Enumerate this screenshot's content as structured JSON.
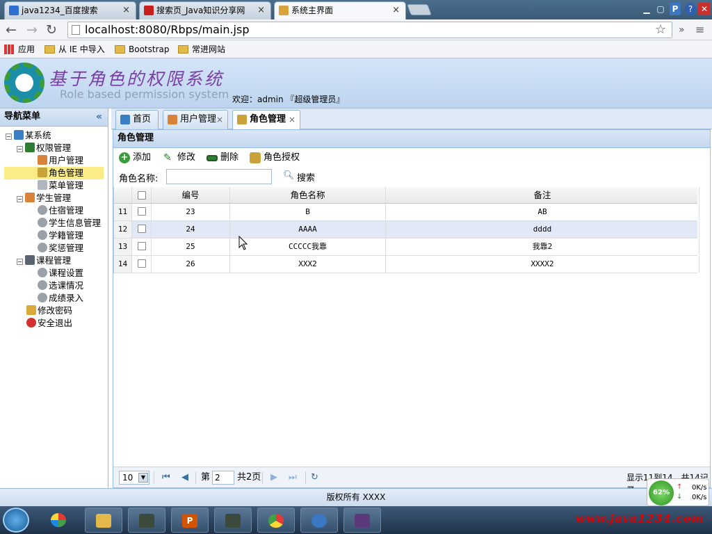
{
  "browser": {
    "tabs": [
      {
        "label": "java1234_百度搜索"
      },
      {
        "label": "搜索页_Java知识分享网"
      },
      {
        "label": "系统主界面"
      }
    ],
    "url": "localhost:8080/Rbps/main.jsp",
    "bookmarks": [
      {
        "label": "应用"
      },
      {
        "label": "从 IE 中导入"
      },
      {
        "label": "Bootstrap"
      },
      {
        "label": "常进网站"
      }
    ]
  },
  "header": {
    "title_cn": "基于角色的权限系统",
    "title_en": "Role based permission system",
    "welcome": "欢迎：admin 『超级管理员』"
  },
  "sidebar": {
    "title": "导航菜单",
    "tree": [
      {
        "label": "某系统"
      },
      {
        "label": "权限管理"
      },
      {
        "label": "用户管理"
      },
      {
        "label": "角色管理"
      },
      {
        "label": "菜单管理"
      },
      {
        "label": "学生管理"
      },
      {
        "label": "住宿管理"
      },
      {
        "label": "学生信息管理"
      },
      {
        "label": "学籍管理"
      },
      {
        "label": "奖惩管理"
      },
      {
        "label": "课程管理"
      },
      {
        "label": "课程设置"
      },
      {
        "label": "选课情况"
      },
      {
        "label": "成绩录入"
      },
      {
        "label": "修改密码"
      },
      {
        "label": "安全退出"
      }
    ]
  },
  "page_tabs": [
    {
      "label": "首页"
    },
    {
      "label": "用户管理"
    },
    {
      "label": "角色管理"
    }
  ],
  "panel": {
    "title": "角色管理",
    "toolbar": {
      "add": "添加",
      "edit": "修改",
      "delete": "删除",
      "grant": "角色授权"
    },
    "search": {
      "label": "角色名称:",
      "button": "搜索",
      "value": ""
    }
  },
  "grid": {
    "columns": [
      "编号",
      "角色名称",
      "备注"
    ],
    "rows": [
      {
        "rownum": "11",
        "id": "23",
        "name": "B",
        "remark": "AB"
      },
      {
        "rownum": "12",
        "id": "24",
        "name": "AAAA",
        "remark": "dddd"
      },
      {
        "rownum": "13",
        "id": "25",
        "name": "CCCCC我靠",
        "remark": "我靠2"
      },
      {
        "rownum": "14",
        "id": "26",
        "name": "XXX2",
        "remark": "XXXX2"
      }
    ]
  },
  "pager": {
    "page_size": "10",
    "page_prefix": "第",
    "page_value": "2",
    "page_total": "共2页",
    "info": "显示11到14，共14记录"
  },
  "footer": {
    "copyright": "版权所有 XXXX"
  },
  "taskbar": {
    "watermark": "www.java1234.com"
  },
  "net_widget": {
    "percent": "62%",
    "up": "0K/s",
    "down": "0K/s"
  },
  "colors": {
    "accent": "#99bbe8",
    "title_purple": "#7a3fa6",
    "selected_node": "#fbec88",
    "row_highlight": "#e2e8f6",
    "watermark_red": "#e00000"
  }
}
